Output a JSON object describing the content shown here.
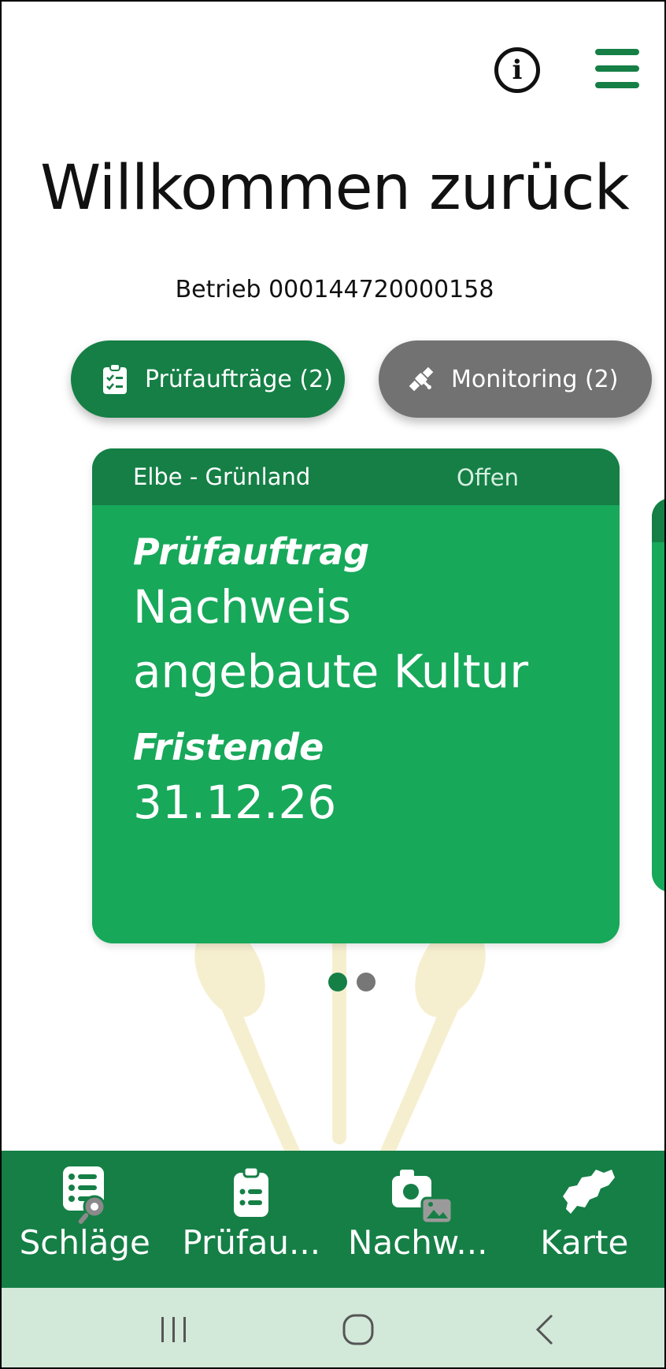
{
  "header": {
    "info_icon": "info-icon",
    "info_glyph": "i",
    "menu_icon": "hamburger-menu-icon"
  },
  "title": "Willkommen zurück",
  "subtitle": "Betrieb 000144720000158",
  "tabs": [
    {
      "label": "Prüfaufträge (2)",
      "icon": "clipboard-checklist-icon",
      "color": "#157f46",
      "active": true
    },
    {
      "label": "Monitoring (2)",
      "icon": "satellite-icon",
      "color": "#727272",
      "active": false
    }
  ],
  "card": {
    "location": "Elbe - Grünland",
    "status": "Offen",
    "type_label": "Prüfauftrag",
    "type_value_line1": "Nachweis",
    "type_value_line2": "angebaute Kultur",
    "deadline_label": "Fristende",
    "deadline_value": "31.12.26"
  },
  "pager": {
    "count": 2,
    "active_index": 0,
    "active_color": "#157f46",
    "inactive_color": "#777777"
  },
  "bottom_nav": [
    {
      "label": "Schläge",
      "icon": "list-search-icon"
    },
    {
      "label": "Prüfau...",
      "icon": "clipboard-list-icon"
    },
    {
      "label": "Nachw...",
      "icon": "camera-gallery-icon"
    },
    {
      "label": "Karte",
      "icon": "map-saxony-icon"
    }
  ],
  "system_nav": [
    {
      "name": "recent-apps-icon",
      "glyph": "|||"
    },
    {
      "name": "home-icon"
    },
    {
      "name": "back-icon"
    }
  ],
  "colors": {
    "primary": "#157f46",
    "card": "#17a85a",
    "secondary": "#727272",
    "system_bar": "#d2e8d9",
    "wheat": "#f5edc8"
  }
}
